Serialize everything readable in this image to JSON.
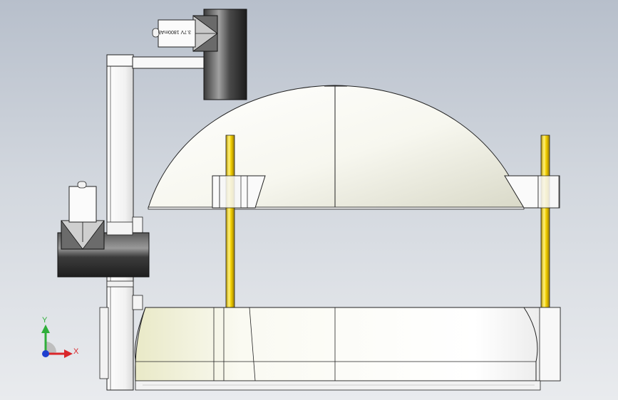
{
  "viewport": {
    "background_top": "#b7bfcb",
    "background_bottom": "#e9ebee"
  },
  "battery_label": "3.7V 1800mAh",
  "triad": {
    "x_label": "X",
    "y_label": "Y",
    "x_color": "#d9262a",
    "y_color": "#2fae3a",
    "z_color": "#1f3fcf"
  },
  "colors": {
    "dome": "#f6f6ec",
    "rod": "#e8c400",
    "frame": "#f4f4f4",
    "dark_cylinder": "#3a3a3a"
  }
}
